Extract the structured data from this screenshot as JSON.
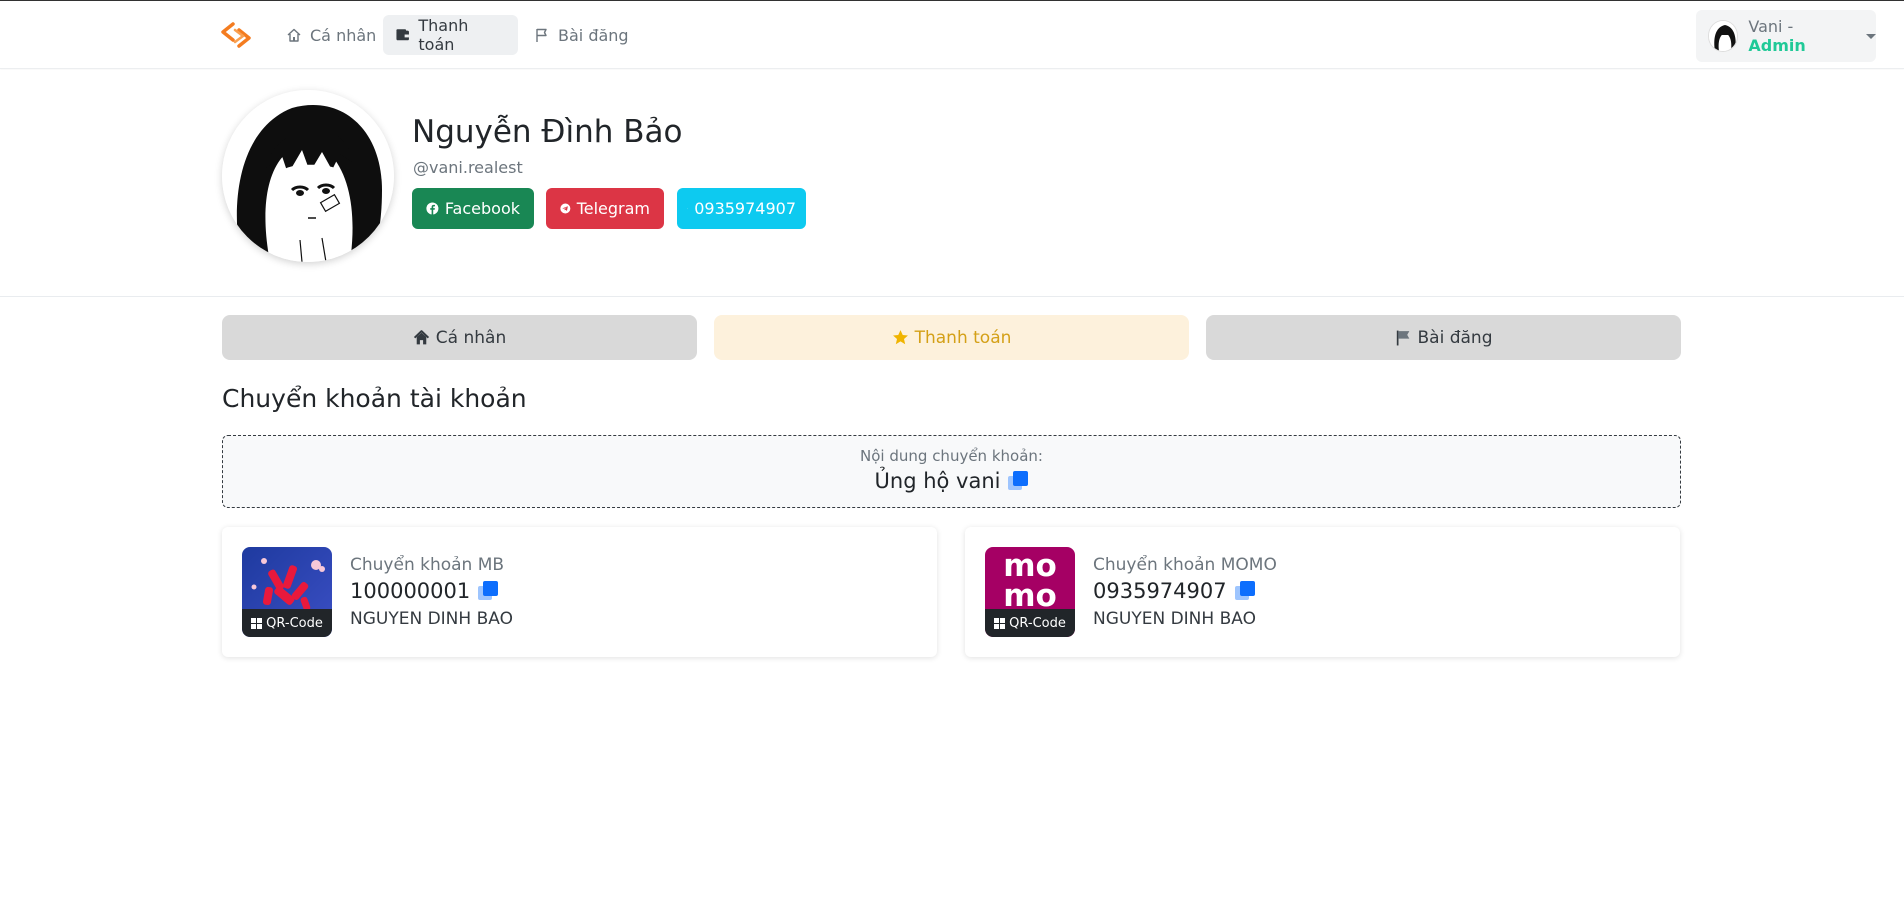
{
  "navbar": {
    "items": [
      {
        "label": "Cá nhân",
        "icon": "home-icon"
      },
      {
        "label": "Thanh toán",
        "icon": "wallet-icon"
      },
      {
        "label": "Bài đăng",
        "icon": "flag-icon"
      }
    ],
    "user": {
      "name": "Vani",
      "separator": " - ",
      "role": "Admin"
    }
  },
  "profile": {
    "name": "Nguyễn Đình Bảo",
    "handle": "@vani.realest",
    "facebook_label": "Facebook",
    "telegram_label": "Telegram",
    "phone_label": "0935974907"
  },
  "tabs": [
    {
      "label": "Cá nhân",
      "icon": "home-icon"
    },
    {
      "label": "Thanh toán",
      "icon": "star-icon"
    },
    {
      "label": "Bài đăng",
      "icon": "flag-icon"
    }
  ],
  "section": {
    "title": "Chuyển khoản tài khoản",
    "transfer_label": "Nội dung chuyển khoản:",
    "transfer_content": "Ủng hộ vani"
  },
  "accounts": [
    {
      "label": "Chuyển khoản MB",
      "number": "100000001",
      "holder": "NGUYEN DINH BAO",
      "qr_label": "QR-Code"
    },
    {
      "label": "Chuyển khoản MOMO",
      "number": "0935974907",
      "holder": "NGUYEN DINH BAO",
      "qr_label": "QR-Code",
      "logo_text": "mo mo"
    }
  ],
  "colors": {
    "accent_orange": "#f47c20",
    "admin_green": "#20c997",
    "facebook": "#198754",
    "telegram": "#dc3545",
    "phone": "#0dcaf0",
    "active_tab_bg": "#fdf1dc",
    "active_tab_text": "#d4a017",
    "copy_blue": "#0d6efd",
    "momo": "#a50064"
  }
}
